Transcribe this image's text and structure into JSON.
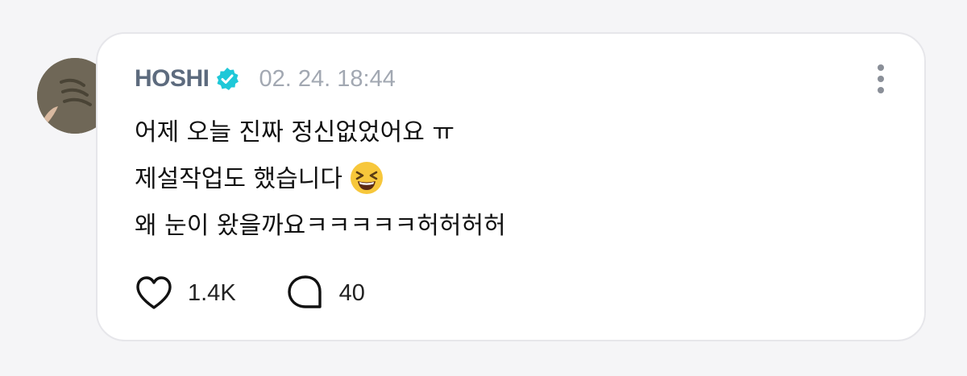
{
  "post": {
    "author": "HOSHI",
    "timestamp": "02. 24. 18:44",
    "lines": [
      "어제 오늘 진짜 정신없었어요 ㅠ",
      "제설작업도 했습니다",
      "왜 눈이 왔을까요ㅋㅋㅋㅋㅋ허허허허"
    ],
    "emoji": "grinning-squinting-face-emoji",
    "likes": "1.4K",
    "comments": "40"
  },
  "icons": {
    "verified": "verified-badge-icon",
    "more": "more-vertical-icon",
    "like": "heart-icon",
    "comment": "speech-bubble-icon"
  },
  "colors": {
    "author": "#5d6b7e",
    "timestamp": "#a2a8b2",
    "verified": "#1ec8d8",
    "card_border": "#e6e6ea",
    "background": "#f5f5f7"
  }
}
